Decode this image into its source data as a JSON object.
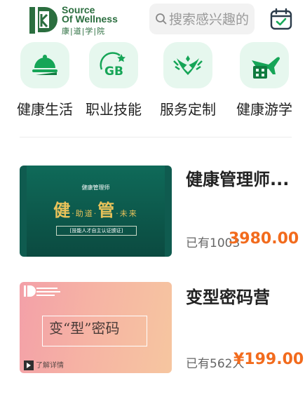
{
  "header": {
    "logo": {
      "line1": "Source",
      "line2": "Of Wellness",
      "line3": "康|道|学|院"
    },
    "search": {
      "placeholder": "搜索感兴趣的"
    },
    "accent": "#2b6e3f"
  },
  "categories": [
    {
      "label": "健康生活",
      "icon": "cloche-icon"
    },
    {
      "label": "职业技能",
      "icon": "gb-standard-icon"
    },
    {
      "label": "服务定制",
      "icon": "wreath-icon"
    },
    {
      "label": "健康游学",
      "icon": "plane-building-icon"
    }
  ],
  "courses": [
    {
      "title": "健康管理师...",
      "meta": "已有1003",
      "price": "3980.00",
      "thumb": {
        "top": "健康管理师",
        "main1": "健",
        "sub1": "·助道·",
        "main2": "管",
        "sub2": "·未来",
        "bottom": "[技能人才自主认证颁证]"
      }
    },
    {
      "title": "变型密码营",
      "meta": "已有562人",
      "price": "¥199.00",
      "thumb": {
        "text": "变“型”密码",
        "cta": "了解详情"
      }
    }
  ],
  "colors": {
    "price": "#f26b1d",
    "category_bg": "#e6f7ee",
    "icon_green": "#1aaa5a"
  }
}
